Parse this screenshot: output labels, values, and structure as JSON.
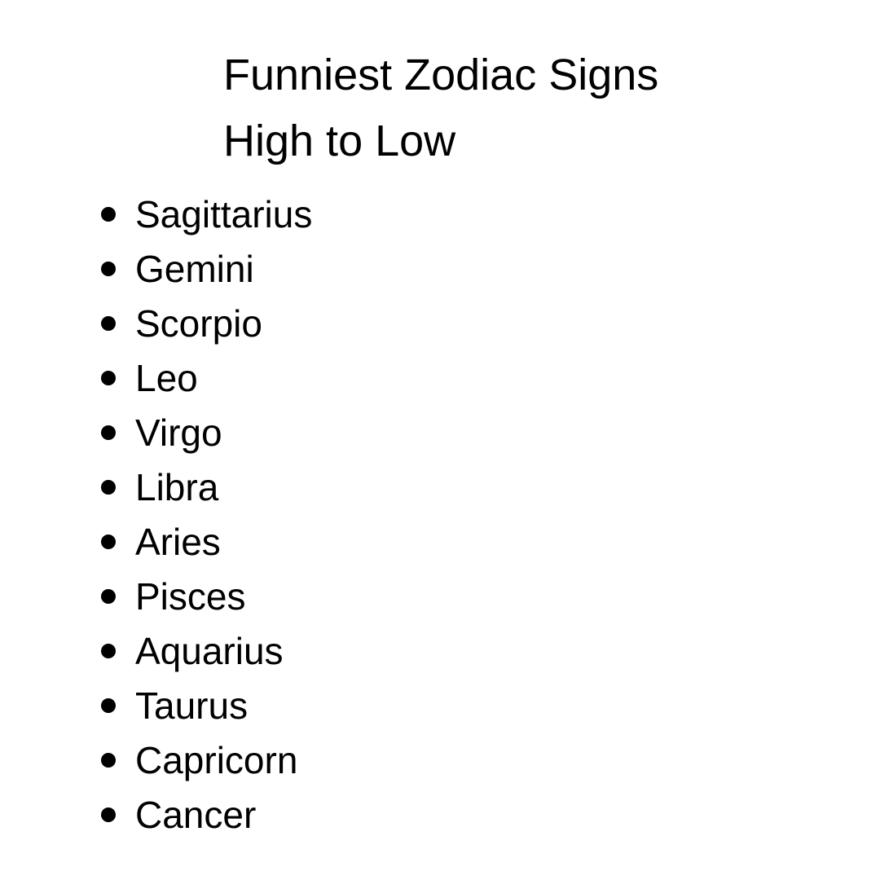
{
  "title": {
    "line1": "Funniest Zodiac Signs",
    "line2": "High to Low"
  },
  "signs": [
    "Sagittarius",
    "Gemini",
    "Scorpio",
    "Leo",
    "Virgo",
    "Libra",
    "Aries",
    "Pisces",
    "Aquarius",
    "Taurus",
    "Capricorn",
    "Cancer"
  ],
  "colors": {
    "text": "#000000",
    "background": "#ffffff"
  }
}
